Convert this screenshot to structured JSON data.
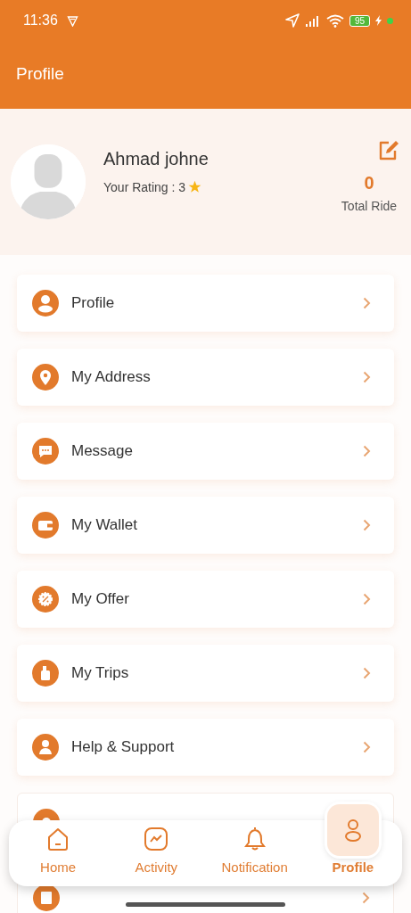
{
  "status_bar": {
    "time": "11:36",
    "battery": "95"
  },
  "header": {
    "title": "Profile"
  },
  "user": {
    "name": "Ahmad johne",
    "rating_label": "Your Rating : ",
    "rating": "3",
    "rides": "0",
    "rides_label": "Total Ride"
  },
  "menu": [
    {
      "label": "Profile",
      "covered": false
    },
    {
      "label": "My Address",
      "covered": false
    },
    {
      "label": "Message",
      "covered": false
    },
    {
      "label": "My Wallet",
      "covered": false
    },
    {
      "label": "My Offer",
      "covered": false
    },
    {
      "label": "My Trips",
      "covered": false
    },
    {
      "label": "Help & Support",
      "covered": false
    },
    {
      "covered": true
    },
    {
      "covered": true
    }
  ],
  "nav": [
    {
      "label": "Home",
      "selected": false
    },
    {
      "label": "Activity",
      "selected": false
    },
    {
      "label": "Notification",
      "selected": false
    },
    {
      "label": "Profile",
      "selected": true
    }
  ]
}
